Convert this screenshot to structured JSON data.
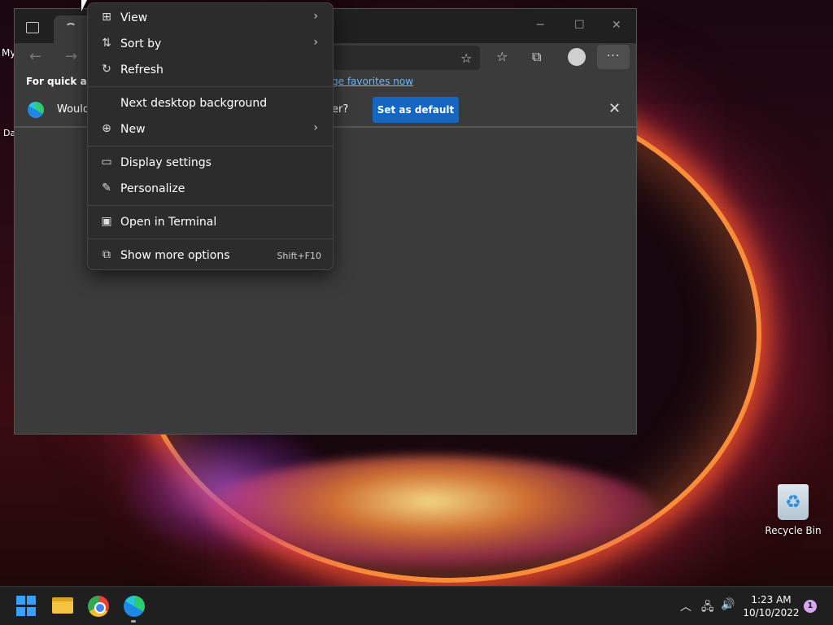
{
  "desktop": {
    "left_label_top": "My",
    "left_label_bottom": "Da",
    "recycle_bin_label": "Recycle Bin"
  },
  "browser": {
    "favorites_bar": {
      "lead_text": "For quick acc",
      "link_text": "ge favorites now"
    },
    "default_notice": {
      "question_start": "Would",
      "question_end": "er?",
      "set_default_label": "Set as default"
    },
    "toolbar": {
      "more_label": "···"
    }
  },
  "context_menu": {
    "items": [
      {
        "label": "View",
        "icon": "grid-icon",
        "submenu": true
      },
      {
        "label": "Sort by",
        "icon": "sort-icon",
        "submenu": true
      },
      {
        "label": "Refresh",
        "icon": "refresh-icon",
        "submenu": false
      },
      {
        "label": "Next desktop background",
        "icon": "",
        "submenu": false
      },
      {
        "label": "New",
        "icon": "plus-circle-icon",
        "submenu": true
      },
      {
        "label": "Display settings",
        "icon": "display-icon",
        "submenu": false
      },
      {
        "label": "Personalize",
        "icon": "brush-icon",
        "submenu": false
      },
      {
        "label": "Open in Terminal",
        "icon": "terminal-icon",
        "submenu": false
      },
      {
        "label": "Show more options",
        "icon": "more-options-icon",
        "shortcut": "Shift+F10"
      }
    ]
  },
  "taskbar": {
    "clock_time": "1:23 AM",
    "clock_date": "10/10/2022",
    "notification_count": "1"
  }
}
